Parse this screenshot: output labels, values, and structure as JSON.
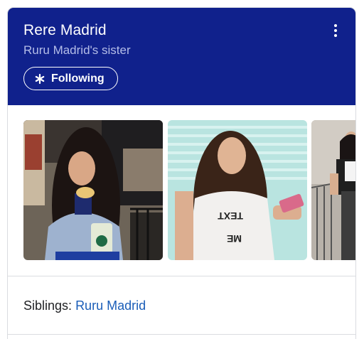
{
  "header": {
    "title": "Rere Madrid",
    "subtitle": "Ruru Madrid's sister",
    "follow_label": "Following",
    "follow_icon": "asterisk-icon",
    "more_icon": "more-vert-icon",
    "background_color": "#10218c"
  },
  "gallery": {
    "photos": [
      {
        "name": "photo-1"
      },
      {
        "name": "photo-2"
      },
      {
        "name": "photo-3"
      }
    ]
  },
  "siblings": {
    "label": "Siblings:",
    "link_text": "Ruru Madrid",
    "link_color": "#1a5db8"
  }
}
